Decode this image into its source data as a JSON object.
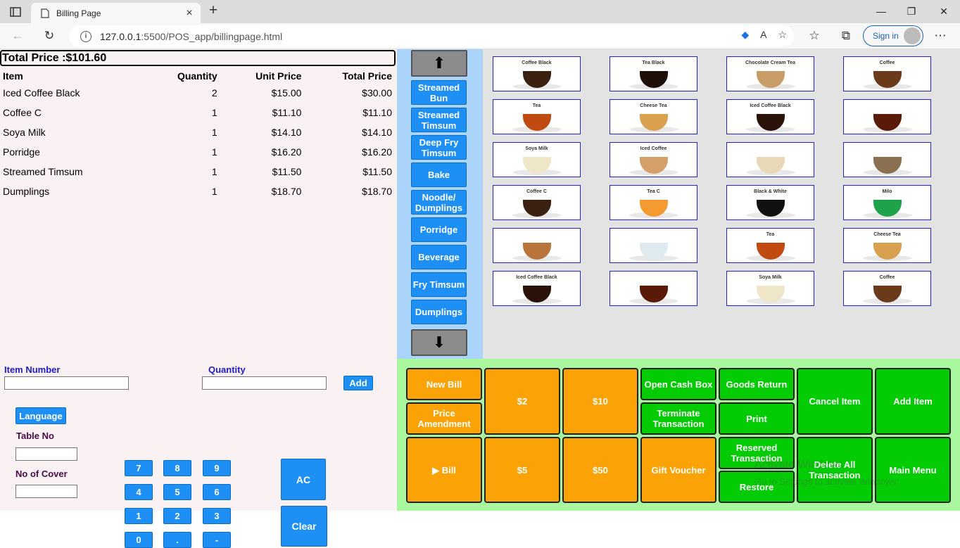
{
  "browser": {
    "tab_title": "Billing Page",
    "url_host": "127.0.0.1",
    "url_rest": ":5500/POS_app/billingpage.html",
    "sign_in": "Sign in"
  },
  "bill": {
    "total_label": "Total Price :$101.60",
    "columns": [
      "Item",
      "Quantity",
      "Unit Price",
      "Total Price"
    ],
    "rows": [
      [
        "Iced Coffee Black",
        "2",
        "$15.00",
        "$30.00"
      ],
      [
        "Coffee C",
        "1",
        "$11.10",
        "$11.10"
      ],
      [
        "Soya Milk",
        "1",
        "$14.10",
        "$14.10"
      ],
      [
        "Porridge",
        "1",
        "$16.20",
        "$16.20"
      ],
      [
        "Streamed Timsum",
        "1",
        "$11.50",
        "$11.50"
      ],
      [
        "Dumplings",
        "1",
        "$18.70",
        "$18.70"
      ]
    ]
  },
  "categories": {
    "up_icon": "arrow-up-icon",
    "down_icon": "arrow-down-icon",
    "items": [
      "Streamed Bun",
      "Streamed Timsum",
      "Deep Fry Timsum",
      "Bake",
      "Noodle/ Dumplings",
      "Porridge",
      "Beverage",
      "Fry Timsum",
      "Dumplings"
    ]
  },
  "menu_items": [
    {
      "caption": "Coffee Black",
      "drink": "#3a2010"
    },
    {
      "caption": "Tea Black",
      "drink": "#1e1008"
    },
    {
      "caption": "Chocolate Cream Tea",
      "drink": "#c89c66"
    },
    {
      "caption": "Coffee",
      "drink": "#6b3a1a"
    },
    {
      "caption": "Tea",
      "drink": "#c04a10"
    },
    {
      "caption": "Cheese Tea",
      "drink": "#d9a050"
    },
    {
      "caption": "Iced Coffee Black",
      "drink": "#2a1208"
    },
    {
      "caption": "",
      "drink": "#5a1a08"
    },
    {
      "caption": "Soya Milk",
      "drink": "#efe6c8"
    },
    {
      "caption": "Iced Coffee",
      "drink": "#d6a06a"
    },
    {
      "caption": "",
      "drink": "#e8d8b8"
    },
    {
      "caption": "",
      "drink": "#8a7050"
    },
    {
      "caption": "Coffee C",
      "drink": "#3a2010"
    },
    {
      "caption": "Tea C",
      "drink": "#f49a30"
    },
    {
      "caption": "Black & White",
      "drink": "#111111"
    },
    {
      "caption": "Milo",
      "drink": "#1ea34a"
    },
    {
      "caption": "",
      "drink": "#b8743a"
    },
    {
      "caption": "",
      "drink": "#dfeaf0"
    },
    {
      "caption": "Tea",
      "drink": "#c04a10"
    },
    {
      "caption": "Cheese Tea",
      "drink": "#d9a050"
    },
    {
      "caption": "Iced Coffee Black",
      "drink": "#2a1208"
    },
    {
      "caption": "",
      "drink": "#5a1a08"
    },
    {
      "caption": "Soya Milk",
      "drink": "#efe6c8"
    },
    {
      "caption": "Coffee",
      "drink": "#6b3a1a"
    }
  ],
  "entry": {
    "item_number_label": "Item Number",
    "quantity_label": "Quantity",
    "add_label": "Add",
    "language_label": "Language",
    "table_no_label": "Table No",
    "no_of_cover_label": "No of Cover",
    "keypad": [
      "7",
      "8",
      "9",
      "4",
      "5",
      "6",
      "1",
      "2",
      "3",
      "0",
      ".",
      "-"
    ],
    "ac_label": "AC",
    "clear_label": "Clear"
  },
  "actions": {
    "new_bill": "New Bill",
    "price_amendment": "Price Amendment",
    "bill": "▶ Bill",
    "two": "$2",
    "five": "$5",
    "ten": "$10",
    "fifty": "$50",
    "open_cash_box": "Open Cash Box",
    "terminate_transaction": "Terminate Transaction",
    "gift_voucher": "Gift Voucher",
    "goods_return": "Goods Return",
    "print": "Print",
    "reserved_transaction": "Reserved Transaction",
    "restore": "Restore",
    "cancel_item": "Cancel Item",
    "delete_all_transaction": "Delete All Transaction",
    "add_item": "Add Item",
    "main_menu": "Main Menu"
  },
  "watermark": {
    "line1": "Activate Windows",
    "line2": "Go to Settings to activate Windows."
  },
  "colors": {
    "category_blue": "#1e8ff5",
    "action_orange": "#fba306",
    "action_green": "#04cc04",
    "action_panel_bg": "#a9f79f",
    "category_panel_bg": "#aad4fa"
  }
}
